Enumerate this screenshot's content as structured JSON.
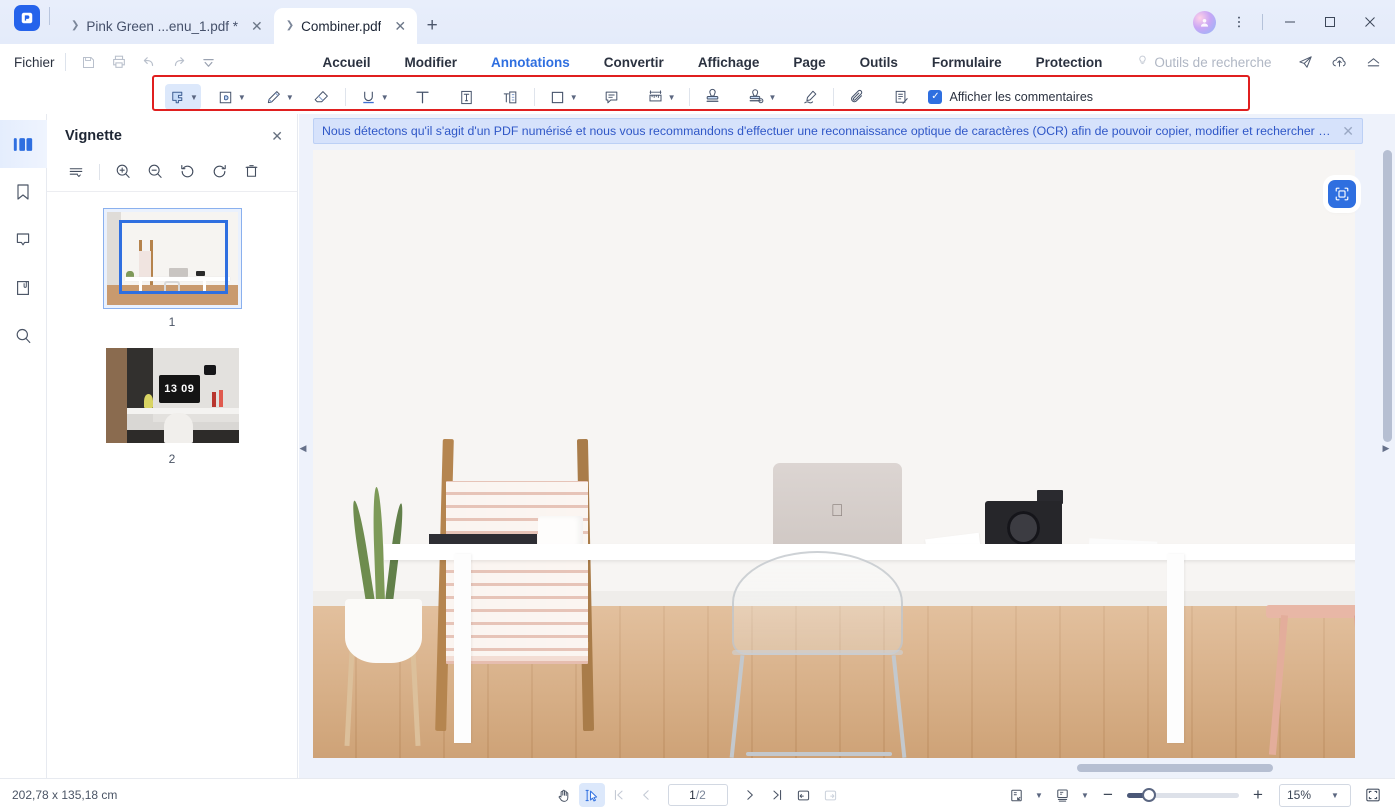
{
  "titlebar": {
    "logo_icon": "pdfelement-logo-icon",
    "tabs": [
      {
        "label": "Pink Green ...enu_1.pdf *",
        "active": false,
        "close_icon": "close-icon",
        "chevron_icon": "chevron-down-icon"
      },
      {
        "label": "Combiner.pdf",
        "active": true,
        "close_icon": "close-icon",
        "chevron_icon": "chevron-down-icon"
      }
    ],
    "new_tab_label": "+",
    "avatar_icon": "user-avatar-icon",
    "more_icon": "more-vertical-icon",
    "minimize_label": "—",
    "maximize_label": "▢",
    "close_label": "✕"
  },
  "menubar": {
    "file_menu": "Fichier",
    "quick_actions": [
      {
        "name": "save-icon"
      },
      {
        "name": "print-icon"
      },
      {
        "name": "undo-icon"
      },
      {
        "name": "redo-icon"
      },
      {
        "name": "customize-toolbar-icon"
      }
    ],
    "ribbon_tabs": [
      {
        "label": "Accueil",
        "active": false
      },
      {
        "label": "Modifier",
        "active": false
      },
      {
        "label": "Annotations",
        "active": true
      },
      {
        "label": "Convertir",
        "active": false
      },
      {
        "label": "Affichage",
        "active": false
      },
      {
        "label": "Page",
        "active": false
      },
      {
        "label": "Outils",
        "active": false
      },
      {
        "label": "Formulaire",
        "active": false
      },
      {
        "label": "Protection",
        "active": false
      }
    ],
    "search_tools_label": "Outils de recherche",
    "right_icons": [
      {
        "name": "send-icon"
      },
      {
        "name": "cloud-upload-icon"
      },
      {
        "name": "collapse-ribbon-icon"
      }
    ]
  },
  "toolbar": {
    "highlight_color": "#e01f1f",
    "tools": [
      {
        "name": "highlight-tool",
        "selected": true,
        "has_caret": true
      },
      {
        "name": "area-highlight-tool",
        "selected": false,
        "has_caret": true
      },
      {
        "name": "pencil-tool",
        "selected": false,
        "has_caret": true
      },
      {
        "name": "eraser-tool",
        "selected": false,
        "has_caret": false
      },
      {
        "name": "underline-tool",
        "selected": false,
        "has_caret": true
      },
      {
        "name": "text-tool",
        "selected": false,
        "has_caret": false
      },
      {
        "name": "text-box-tool",
        "selected": false,
        "has_caret": false
      },
      {
        "name": "typewriter-tool",
        "selected": false,
        "has_caret": false
      },
      {
        "name": "shape-rectangle-tool",
        "selected": false,
        "has_caret": true
      },
      {
        "name": "sticky-note-tool",
        "selected": false,
        "has_caret": false
      },
      {
        "name": "measure-tool",
        "selected": false,
        "has_caret": true
      },
      {
        "name": "stamp-tool",
        "selected": false,
        "has_caret": false
      },
      {
        "name": "custom-stamp-tool",
        "selected": false,
        "has_caret": true
      },
      {
        "name": "signature-tool",
        "selected": false,
        "has_caret": false
      },
      {
        "name": "attachment-tool",
        "selected": false,
        "has_caret": false
      },
      {
        "name": "comment-list-tool",
        "selected": false,
        "has_caret": false
      }
    ],
    "show_comments_label": "Afficher les commentaires",
    "show_comments_checked": true
  },
  "rail": {
    "items": [
      {
        "name": "thumbnails-panel",
        "active": true
      },
      {
        "name": "bookmarks-panel",
        "active": false
      },
      {
        "name": "comments-panel",
        "active": false
      },
      {
        "name": "attachments-panel",
        "active": false
      },
      {
        "name": "search-panel",
        "active": false
      }
    ]
  },
  "thumbnail_panel": {
    "title": "Vignette",
    "close_icon": "close-icon",
    "tools": [
      {
        "name": "thumbnail-size-icon"
      },
      {
        "name": "zoom-in-icon"
      },
      {
        "name": "zoom-out-icon"
      },
      {
        "name": "rotate-left-icon"
      },
      {
        "name": "rotate-right-icon"
      },
      {
        "name": "delete-page-icon"
      }
    ],
    "pages": [
      {
        "number": "1",
        "selected": true
      },
      {
        "number": "2",
        "selected": false,
        "clock_text": "13 09"
      }
    ]
  },
  "viewer": {
    "notice_text": "Nous détectons qu'il s'agit d'un PDF numérisé et nous vous recommandons d'effectuer une reconnaissance optique de caractères (OCR) afin de pouvoir copier, modifier et rechercher du texte",
    "notice_close_icon": "close-icon",
    "ocr_fab_icon": "ocr-scan-icon",
    "collapse_left_icon": "chevron-left-icon",
    "collapse_right_icon": "chevron-right-icon"
  },
  "statusbar": {
    "page_dimensions": "202,78 x 135,18 cm",
    "tools": [
      {
        "name": "hand-tool",
        "selected": false
      },
      {
        "name": "select-tool",
        "selected": true
      }
    ],
    "nav": [
      {
        "name": "first-page-button",
        "label": "|‹",
        "disabled": true
      },
      {
        "name": "previous-page-button",
        "label": "‹",
        "disabled": true
      },
      {
        "name": "next-page-button",
        "label": "›",
        "disabled": false
      },
      {
        "name": "last-page-button",
        "label": "›|",
        "disabled": false
      }
    ],
    "current_page": "1",
    "page_separator": "/2",
    "view_mode_icons": [
      {
        "name": "single-page-view-icon",
        "disabled": false
      },
      {
        "name": "facing-page-view-icon",
        "disabled": true
      }
    ],
    "right_icons": [
      {
        "name": "page-fit-mode-icon",
        "has_caret": true
      },
      {
        "name": "scroll-mode-icon",
        "has_caret": true
      }
    ],
    "zoom_out_label": "−",
    "zoom_in_label": "+",
    "zoom_level": "15%",
    "zoom_caret_icon": "chevron-down-icon",
    "fit_screen_icon": "fit-screen-icon"
  }
}
